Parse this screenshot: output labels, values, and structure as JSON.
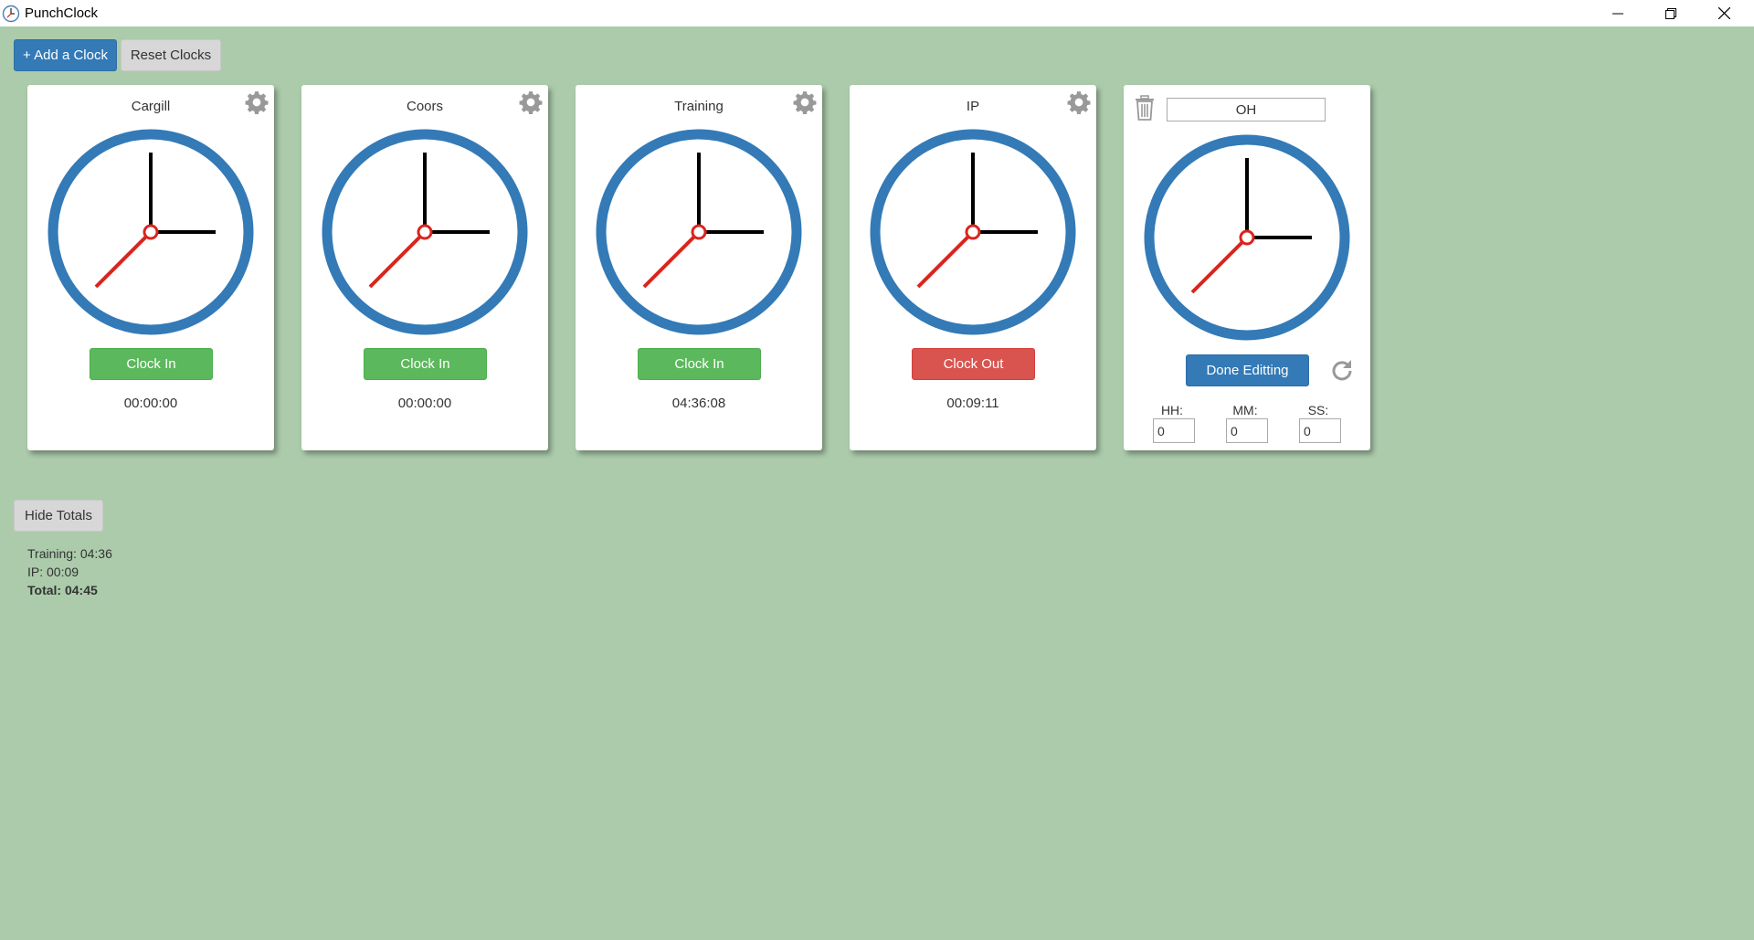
{
  "window": {
    "title": "PunchClock",
    "controls": [
      "minimize-icon",
      "restore-icon",
      "close-icon"
    ]
  },
  "toolbar": {
    "add_clock_label": "+ Add a Clock",
    "reset_clocks_label": "Reset Clocks"
  },
  "clocks": [
    {
      "name": "Cargill",
      "button_label": "Clock In",
      "button_state": "in",
      "elapsed": "00:00:00"
    },
    {
      "name": "Coors",
      "button_label": "Clock In",
      "button_state": "in",
      "elapsed": "00:00:00"
    },
    {
      "name": "Training",
      "button_label": "Clock In",
      "button_state": "in",
      "elapsed": "04:36:08"
    },
    {
      "name": "IP",
      "button_label": "Clock Out",
      "button_state": "out",
      "elapsed": "00:09:11"
    }
  ],
  "edit_clock": {
    "name_value": "OH",
    "done_label": "Done Editting",
    "hh_label": "HH:",
    "mm_label": "MM:",
    "ss_label": "SS:",
    "hh_value": "0",
    "mm_value": "0",
    "ss_value": "0"
  },
  "totals": {
    "toggle_label": "Hide Totals",
    "lines": [
      "Training: 04:36",
      "IP: 00:09"
    ],
    "total": "Total: 04:45"
  },
  "colors": {
    "background": "#abcbab",
    "clock_ring": "#337ab7",
    "second_hand": "#d9251d",
    "clock_in": "#5cb85c",
    "clock_out": "#d9534f",
    "primary": "#337ab7"
  }
}
